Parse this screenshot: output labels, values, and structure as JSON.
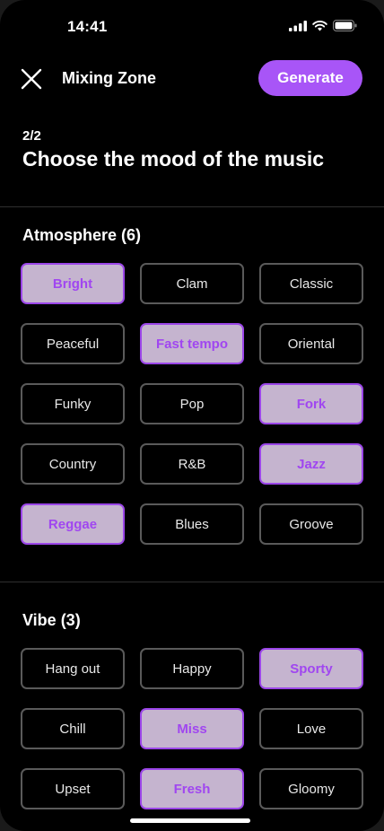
{
  "status": {
    "time": "14:41"
  },
  "header": {
    "title": "Mixing Zone",
    "generate_label": "Generate"
  },
  "step": "2/2",
  "heading": "Choose the mood of the music",
  "sections": [
    {
      "title": "Atmosphere (6)",
      "chips": [
        {
          "label": "Bright",
          "selected": true
        },
        {
          "label": "Clam",
          "selected": false
        },
        {
          "label": "Classic",
          "selected": false
        },
        {
          "label": "Peaceful",
          "selected": false
        },
        {
          "label": "Fast tempo",
          "selected": true
        },
        {
          "label": "Oriental",
          "selected": false
        },
        {
          "label": "Funky",
          "selected": false
        },
        {
          "label": "Pop",
          "selected": false
        },
        {
          "label": "Fork",
          "selected": true
        },
        {
          "label": "Country",
          "selected": false
        },
        {
          "label": "R&B",
          "selected": false
        },
        {
          "label": "Jazz",
          "selected": true
        },
        {
          "label": "Reggae",
          "selected": true
        },
        {
          "label": "Blues",
          "selected": false
        },
        {
          "label": "Groove",
          "selected": false
        }
      ]
    },
    {
      "title": "Vibe (3)",
      "chips": [
        {
          "label": "Hang out",
          "selected": false
        },
        {
          "label": "Happy",
          "selected": false
        },
        {
          "label": "Sporty",
          "selected": true
        },
        {
          "label": "Chill",
          "selected": false
        },
        {
          "label": "Miss",
          "selected": true
        },
        {
          "label": "Love",
          "selected": false
        },
        {
          "label": "Upset",
          "selected": false
        },
        {
          "label": "Fresh",
          "selected": true
        },
        {
          "label": "Gloomy",
          "selected": false
        }
      ]
    }
  ],
  "colors": {
    "accent": "#a855f7",
    "selected_bg": "#c5b4cf",
    "background": "#000000"
  },
  "icons": [
    "signal-icon",
    "wifi-icon",
    "battery-icon",
    "close-icon"
  ]
}
